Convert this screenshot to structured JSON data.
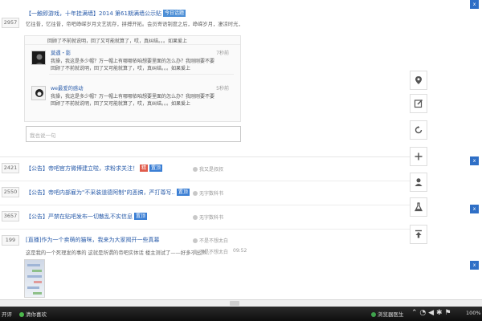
{
  "posts": [
    {
      "count": "2957",
      "title": "【一触即游戏，十年挂满墙】2014 第61期满墙公示贴",
      "tag": "今日话题",
      "abstract": "忆往昔，忆往昔，帝吧峥嵘岁月文艺犹存，拼搏开拓。会员寄语制度之后，峥嵘岁月，凄凉时光，唐音都给，金都云...",
      "reply_prev_line": "回顾了不前就说明，回了又可能就算了，哎，真纠结。。。如果爱上",
      "replies": [
        {
          "name": "莫遇・影",
          "line1": "我操，我这是多少帽？万一帽上有哪哪依咱想要里面的怎么办？我刚刚要不要",
          "line2": "回顾了不前就说明，回了又可能就算了，哎，真纠结。。。如果爱上",
          "time": "7秒前"
        },
        {
          "name": "we最爱的感动",
          "line1": "我操，我这是多少帽？万一帽上有哪哪依咱想要里面的怎么办？我刚刚要不要",
          "line2": "回顾了不前就说明，回了又可能就算了，哎，真纠结。。。如果爱上",
          "time": "5秒前"
        }
      ],
      "input_placeholder": "我也说一句"
    },
    {
      "count": "2421",
      "title": "【公告】帝吧官方微博建立啦，求粉求关注！",
      "tags": [
        "精",
        "置顶"
      ],
      "author": "我又是叔叔"
    },
    {
      "count": "2550",
      "title": "【公告】帝吧内部雇为\"不采装道德阿制\"的恶搞，严打尊写..",
      "tags": [
        "置顶"
      ],
      "author": "无字数科书"
    },
    {
      "count": "3657",
      "title": "【公告】严禁在贴吧发布一切散乱不实信息",
      "tags": [
        "置顶"
      ],
      "author": "无字数科书"
    },
    {
      "count": "199",
      "title": "[直播]作为一个卖萌的猫咪，我来为大家揭开一些真幕",
      "abstract": "这是我的一个死理发的事的 这就是所谓的帝吧实体话 楼主测试了——好多不出声...",
      "author_top": "不是不想太白",
      "author_bottom": "不是不想太白",
      "time": "09:52"
    }
  ],
  "toolbar": {
    "items": [
      "location-icon",
      "edit-icon",
      "refresh-icon",
      "plus-icon",
      "user-icon",
      "lab-icon",
      "top-icon"
    ]
  },
  "close_flag": "x",
  "taskbar": {
    "left_label": "开评",
    "user_label": "清你喜欢",
    "browser_label": "浏览器医生",
    "battery": "100%"
  },
  "colors": {
    "link": "#2a5caa",
    "tag_blue": "#4d8fd6",
    "tag_red": "#e05a4a",
    "flag_blue": "#2f6fc6"
  }
}
